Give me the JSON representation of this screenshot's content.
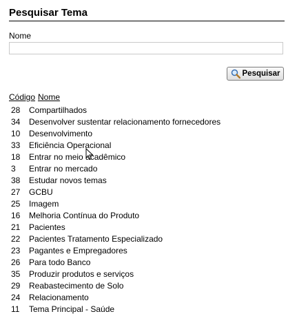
{
  "header": {
    "title": "Pesquisar Tema"
  },
  "form": {
    "name_label": "Nome",
    "name_value": "",
    "search_button_label": "Pesquisar",
    "search_icon": "magnifier-icon"
  },
  "table": {
    "headers": {
      "code": "Código",
      "name": "Nome"
    },
    "rows": [
      {
        "code": "28",
        "name": "Compartilhados"
      },
      {
        "code": "34",
        "name": "Desenvolver sustentar relacionamento fornecedores"
      },
      {
        "code": "10",
        "name": "Desenvolvimento"
      },
      {
        "code": "33",
        "name": "Eficiência Operacional"
      },
      {
        "code": "18",
        "name": "Entrar no meio acadêmico"
      },
      {
        "code": "3",
        "name": "Entrar no mercado"
      },
      {
        "code": "38",
        "name": "Estudar novos temas"
      },
      {
        "code": "27",
        "name": "GCBU"
      },
      {
        "code": "25",
        "name": "Imagem"
      },
      {
        "code": "16",
        "name": "Melhoria Contínua do Produto"
      },
      {
        "code": "21",
        "name": "Pacientes"
      },
      {
        "code": "22",
        "name": "Pacientes Tratamento Especializado"
      },
      {
        "code": "23",
        "name": "Pagantes e Empregadores"
      },
      {
        "code": "26",
        "name": "Para todo Banco"
      },
      {
        "code": "35",
        "name": "Produzir produtos e serviços"
      },
      {
        "code": "29",
        "name": "Reabastecimento de Solo"
      },
      {
        "code": "24",
        "name": "Relacionamento"
      },
      {
        "code": "11",
        "name": "Tema Principal - Saúde"
      }
    ]
  }
}
